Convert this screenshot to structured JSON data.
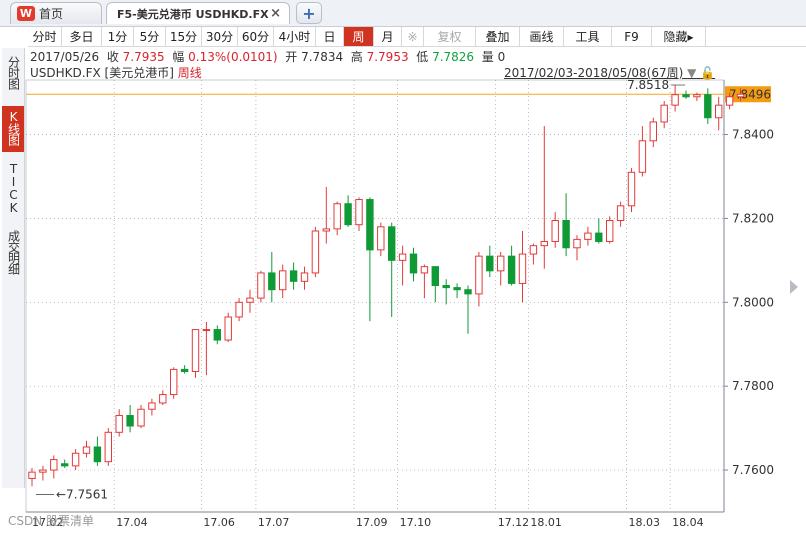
{
  "tabs": {
    "home_label": "首页",
    "home_icon_text": "W",
    "active_label": "F5-美元兑港币 USDHKD.FX",
    "close_glyph": "×",
    "add_glyph": "+"
  },
  "toolbar": {
    "items": [
      "分时",
      "多日",
      "1分",
      "5分",
      "15分",
      "30分",
      "60分",
      "4小时",
      "日",
      "周",
      "月",
      "※",
      "复权",
      "叠加",
      "画线",
      "工具",
      "F9",
      "隐藏▸"
    ],
    "active": "周"
  },
  "left_nav": [
    {
      "label": "分时图",
      "active": false
    },
    {
      "label": "K线图",
      "active": true
    },
    {
      "label": "TICK",
      "active": false
    },
    {
      "label": "成交明细",
      "active": false
    }
  ],
  "info": {
    "date": "2017/05/26",
    "close_label": "收",
    "close_value": "7.7935",
    "change_label": "幅",
    "change_value": "0.13%(0.0101)",
    "open_label": "开",
    "open_value": "7.7834",
    "high_label": "高",
    "high_value": "7.7953",
    "low_label": "低",
    "low_value": "7.7826",
    "volume_label": "量",
    "volume_value": "0"
  },
  "chart_header": {
    "symbol": "USDHKD.FX [美元兑港币]",
    "period": "周线",
    "range": "2017/02/03-2018/05/08(67周)"
  },
  "chart_data": {
    "type": "candlestick",
    "period": "weekly",
    "ylim": [
      7.75,
      7.853
    ],
    "y_ticks": [
      "7.8496",
      "7.8400",
      "7.8200",
      "7.8000",
      "7.7800",
      "7.7600"
    ],
    "y_tick_values": [
      7.8496,
      7.84,
      7.82,
      7.8,
      7.78,
      7.76
    ],
    "current_price": "7.8496",
    "current_price_value": 7.8496,
    "x_ticks": [
      {
        "label": "17.04",
        "index": 8
      },
      {
        "label": "17.06",
        "index": 16
      },
      {
        "label": "17.07",
        "index": 21
      },
      {
        "label": "17.09",
        "index": 30
      },
      {
        "label": "17.10",
        "index": 34
      },
      {
        "label": "17.12",
        "index": 43
      },
      {
        "label": "18.01",
        "index": 46
      },
      {
        "label": "18.03",
        "index": 55
      },
      {
        "label": "18.04",
        "index": 59
      }
    ],
    "x_extra_label": "17.02",
    "max_label": "7.8518",
    "max_value": 7.8518,
    "max_index": 59,
    "min_label": "7.7561",
    "min_value": 7.7561,
    "min_index": 0,
    "candles": [
      {
        "o": 7.758,
        "h": 7.7605,
        "l": 7.7561,
        "c": 7.7595
      },
      {
        "o": 7.7595,
        "h": 7.761,
        "l": 7.7575,
        "c": 7.76
      },
      {
        "o": 7.76,
        "h": 7.7635,
        "l": 7.758,
        "c": 7.7625
      },
      {
        "o": 7.7615,
        "h": 7.7625,
        "l": 7.7605,
        "c": 7.761
      },
      {
        "o": 7.761,
        "h": 7.765,
        "l": 7.76,
        "c": 7.764
      },
      {
        "o": 7.764,
        "h": 7.767,
        "l": 7.763,
        "c": 7.7655
      },
      {
        "o": 7.7655,
        "h": 7.768,
        "l": 7.761,
        "c": 7.762
      },
      {
        "o": 7.762,
        "h": 7.77,
        "l": 7.761,
        "c": 7.769
      },
      {
        "o": 7.769,
        "h": 7.7745,
        "l": 7.768,
        "c": 7.773
      },
      {
        "o": 7.773,
        "h": 7.7755,
        "l": 7.769,
        "c": 7.7705
      },
      {
        "o": 7.7705,
        "h": 7.7755,
        "l": 7.77,
        "c": 7.7745
      },
      {
        "o": 7.7745,
        "h": 7.777,
        "l": 7.773,
        "c": 7.776
      },
      {
        "o": 7.776,
        "h": 7.779,
        "l": 7.7755,
        "c": 7.778
      },
      {
        "o": 7.778,
        "h": 7.7845,
        "l": 7.777,
        "c": 7.784
      },
      {
        "o": 7.784,
        "h": 7.785,
        "l": 7.783,
        "c": 7.7835
      },
      {
        "o": 7.7835,
        "h": 7.786,
        "l": 7.782,
        "c": 7.7935
      },
      {
        "o": 7.7935,
        "h": 7.7953,
        "l": 7.7826,
        "c": 7.7935
      },
      {
        "o": 7.7935,
        "h": 7.7945,
        "l": 7.79,
        "c": 7.791
      },
      {
        "o": 7.791,
        "h": 7.7975,
        "l": 7.7905,
        "c": 7.7965
      },
      {
        "o": 7.7965,
        "h": 7.801,
        "l": 7.7955,
        "c": 7.8
      },
      {
        "o": 7.8,
        "h": 7.803,
        "l": 7.7975,
        "c": 7.801
      },
      {
        "o": 7.801,
        "h": 7.8075,
        "l": 7.8,
        "c": 7.807
      },
      {
        "o": 7.807,
        "h": 7.812,
        "l": 7.8,
        "c": 7.803
      },
      {
        "o": 7.803,
        "h": 7.809,
        "l": 7.801,
        "c": 7.8075
      },
      {
        "o": 7.8075,
        "h": 7.8095,
        "l": 7.803,
        "c": 7.805
      },
      {
        "o": 7.805,
        "h": 7.8085,
        "l": 7.803,
        "c": 7.807
      },
      {
        "o": 7.807,
        "h": 7.818,
        "l": 7.806,
        "c": 7.817
      },
      {
        "o": 7.817,
        "h": 7.8275,
        "l": 7.814,
        "c": 7.8175
      },
      {
        "o": 7.8175,
        "h": 7.824,
        "l": 7.816,
        "c": 7.8235
      },
      {
        "o": 7.8235,
        "h": 7.8255,
        "l": 7.818,
        "c": 7.8185
      },
      {
        "o": 7.8185,
        "h": 7.825,
        "l": 7.817,
        "c": 7.8245
      },
      {
        "o": 7.8245,
        "h": 7.825,
        "l": 7.7955,
        "c": 7.8125
      },
      {
        "o": 7.8125,
        "h": 7.819,
        "l": 7.811,
        "c": 7.818
      },
      {
        "o": 7.818,
        "h": 7.819,
        "l": 7.7965,
        "c": 7.81
      },
      {
        "o": 7.81,
        "h": 7.8135,
        "l": 7.804,
        "c": 7.8115
      },
      {
        "o": 7.8115,
        "h": 7.813,
        "l": 7.805,
        "c": 7.807
      },
      {
        "o": 7.807,
        "h": 7.809,
        "l": 7.801,
        "c": 7.8085
      },
      {
        "o": 7.8085,
        "h": 7.8085,
        "l": 7.8,
        "c": 7.804
      },
      {
        "o": 7.804,
        "h": 7.8055,
        "l": 7.7995,
        "c": 7.8035
      },
      {
        "o": 7.8035,
        "h": 7.8045,
        "l": 7.801,
        "c": 7.803
      },
      {
        "o": 7.803,
        "h": 7.804,
        "l": 7.7925,
        "c": 7.802
      },
      {
        "o": 7.802,
        "h": 7.812,
        "l": 7.799,
        "c": 7.811
      },
      {
        "o": 7.811,
        "h": 7.8135,
        "l": 7.806,
        "c": 7.8075
      },
      {
        "o": 7.8075,
        "h": 7.812,
        "l": 7.804,
        "c": 7.811
      },
      {
        "o": 7.811,
        "h": 7.8135,
        "l": 7.804,
        "c": 7.8045
      },
      {
        "o": 7.8045,
        "h": 7.817,
        "l": 7.8,
        "c": 7.8115
      },
      {
        "o": 7.8115,
        "h": 7.814,
        "l": 7.809,
        "c": 7.8135
      },
      {
        "o": 7.8135,
        "h": 7.842,
        "l": 7.808,
        "c": 7.8145
      },
      {
        "o": 7.8145,
        "h": 7.8215,
        "l": 7.813,
        "c": 7.8195
      },
      {
        "o": 7.8195,
        "h": 7.826,
        "l": 7.811,
        "c": 7.813
      },
      {
        "o": 7.813,
        "h": 7.816,
        "l": 7.81,
        "c": 7.815
      },
      {
        "o": 7.815,
        "h": 7.818,
        "l": 7.8135,
        "c": 7.8165
      },
      {
        "o": 7.8165,
        "h": 7.82,
        "l": 7.814,
        "c": 7.8145
      },
      {
        "o": 7.8145,
        "h": 7.8205,
        "l": 7.814,
        "c": 7.8195
      },
      {
        "o": 7.8195,
        "h": 7.824,
        "l": 7.818,
        "c": 7.823
      },
      {
        "o": 7.823,
        "h": 7.832,
        "l": 7.8215,
        "c": 7.831
      },
      {
        "o": 7.831,
        "h": 7.842,
        "l": 7.83,
        "c": 7.8385
      },
      {
        "o": 7.8385,
        "h": 7.844,
        "l": 7.837,
        "c": 7.843
      },
      {
        "o": 7.843,
        "h": 7.848,
        "l": 7.8415,
        "c": 7.847
      },
      {
        "o": 7.847,
        "h": 7.8518,
        "l": 7.8455,
        "c": 7.8495
      },
      {
        "o": 7.8495,
        "h": 7.8505,
        "l": 7.8485,
        "c": 7.849
      },
      {
        "o": 7.849,
        "h": 7.85,
        "l": 7.848,
        "c": 7.8495
      },
      {
        "o": 7.8495,
        "h": 7.851,
        "l": 7.8425,
        "c": 7.844
      },
      {
        "o": 7.844,
        "h": 7.849,
        "l": 7.841,
        "c": 7.847
      },
      {
        "o": 7.847,
        "h": 7.85,
        "l": 7.846,
        "c": 7.849
      },
      {
        "o": 7.849,
        "h": 7.851,
        "l": 7.848,
        "c": 7.8496
      }
    ],
    "colors": {
      "up": "#e23b3b",
      "down": "#0f9a36",
      "grid": "#9aa0aa",
      "price_line": "#f5a623"
    }
  },
  "watermark": "CSDN 股票清单"
}
